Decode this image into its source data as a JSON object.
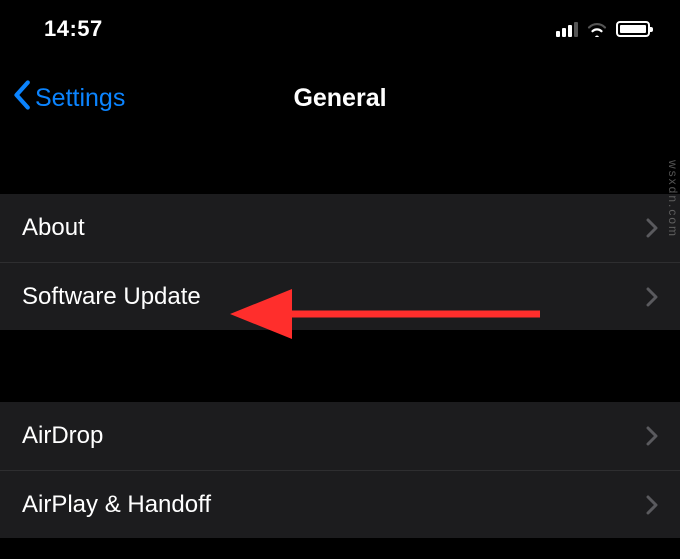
{
  "status": {
    "time": "14:57"
  },
  "nav": {
    "back_label": "Settings",
    "title": "General"
  },
  "sections": [
    {
      "rows": [
        {
          "label": "About"
        },
        {
          "label": "Software Update"
        }
      ]
    },
    {
      "rows": [
        {
          "label": "AirDrop"
        },
        {
          "label": "AirPlay & Handoff"
        }
      ]
    }
  ],
  "annotation": {
    "arrow_color": "#ff2e2c"
  },
  "watermark": "wsxdn.com"
}
